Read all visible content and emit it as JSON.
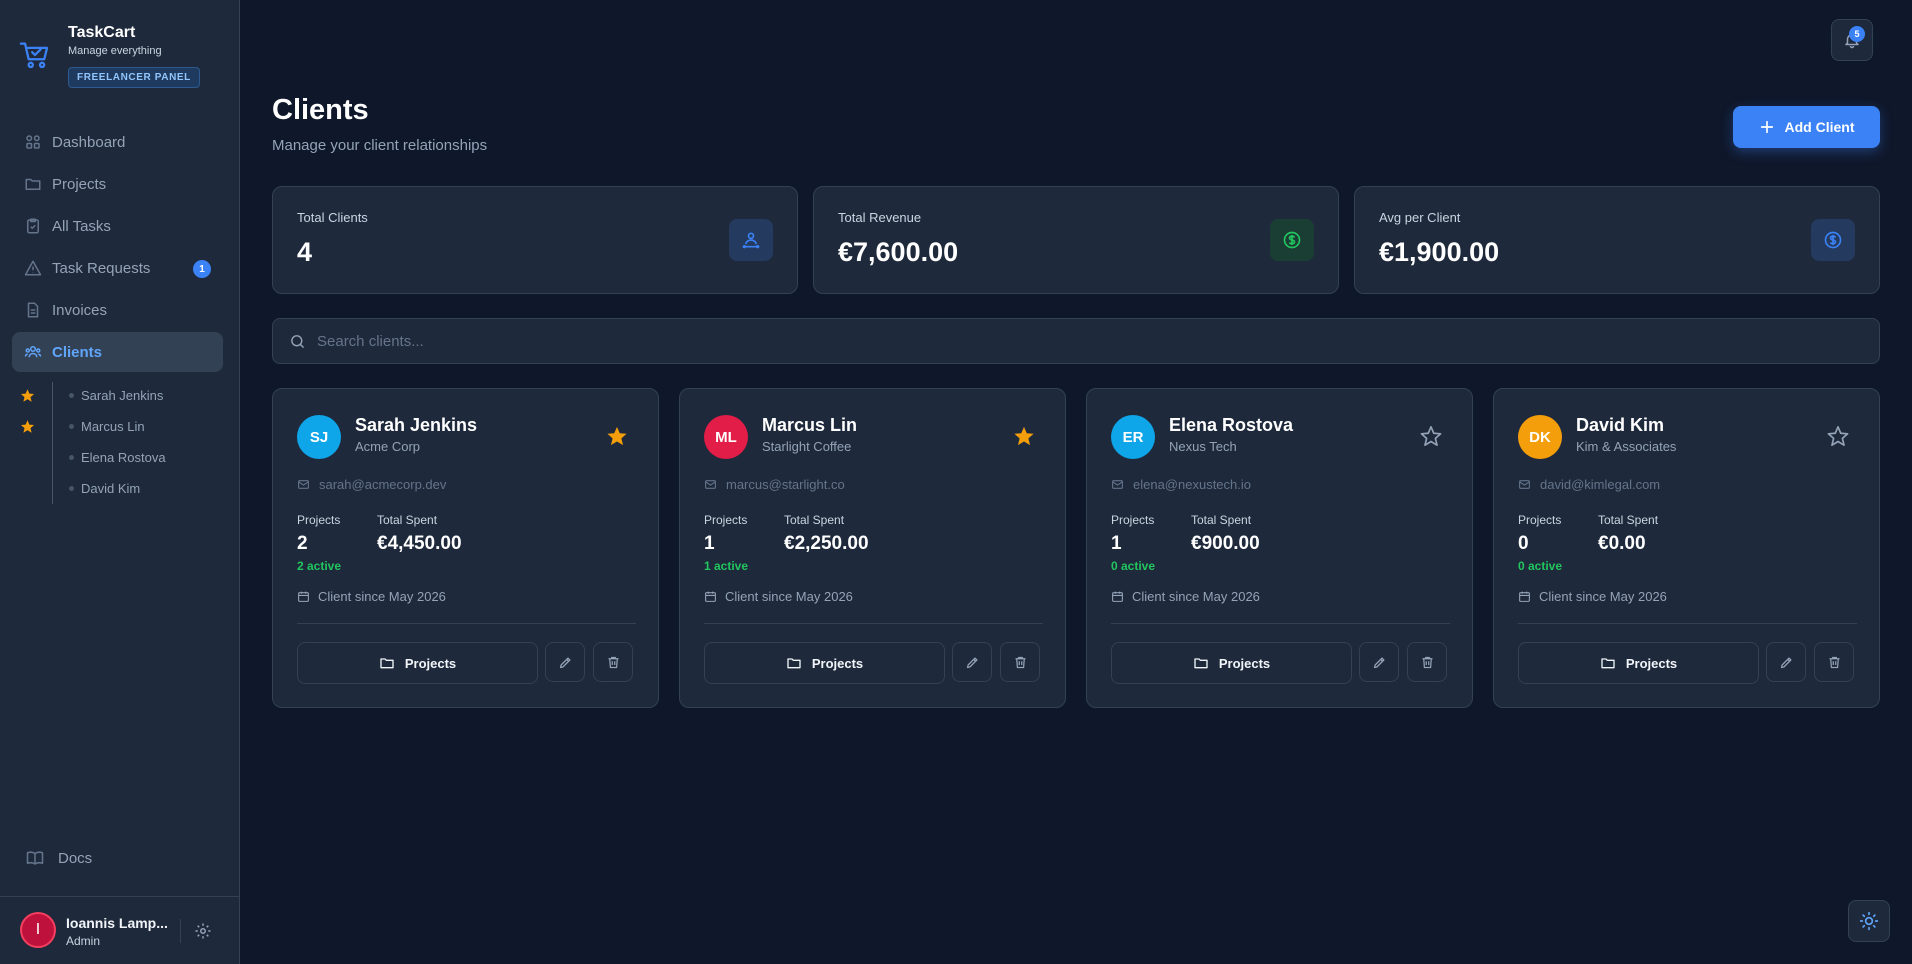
{
  "brand": {
    "name": "TaskCart",
    "subtitle": "Manage everything",
    "badge": "FREELANCER PANEL"
  },
  "nav": {
    "items": [
      {
        "label": "Dashboard",
        "icon": "grid-icon"
      },
      {
        "label": "Projects",
        "icon": "folder-icon"
      },
      {
        "label": "All Tasks",
        "icon": "clipboard-check-icon"
      },
      {
        "label": "Task Requests",
        "icon": "warning-triangle-icon",
        "count": "1"
      },
      {
        "label": "Invoices",
        "icon": "document-icon"
      },
      {
        "label": "Clients",
        "icon": "users-icon",
        "active": true
      }
    ]
  },
  "client_shortcuts": [
    {
      "name": "Sarah Jenkins",
      "starred": true
    },
    {
      "name": "Marcus Lin",
      "starred": true
    },
    {
      "name": "Elena Rostova",
      "starred": false
    },
    {
      "name": "David Kim",
      "starred": false
    }
  ],
  "docs": {
    "label": "Docs",
    "icon": "book-icon"
  },
  "user": {
    "initial": "I",
    "name": "Ioannis Lamp...",
    "role": "Admin"
  },
  "header": {
    "notifications_count": "5"
  },
  "page": {
    "title": "Clients",
    "subtitle": "Manage your client relationships",
    "add_button": "Add Client"
  },
  "stats": [
    {
      "label": "Total Clients",
      "value": "4",
      "icon": "user-network-icon",
      "color": "#3b82f6"
    },
    {
      "label": "Total Revenue",
      "value": "€7,600.00",
      "icon": "dollar-circle-icon",
      "color": "#22c55e"
    },
    {
      "label": "Avg per Client",
      "value": "€1,900.00",
      "icon": "dollar-circle-icon",
      "color": "#3b82f6"
    }
  ],
  "search": {
    "placeholder": "Search clients...",
    "value": ""
  },
  "clients": [
    {
      "initials": "SJ",
      "name": "Sarah Jenkins",
      "company": "Acme Corp",
      "email": "sarah@acmecorp.dev",
      "projects_label": "Projects",
      "projects": "2",
      "active": "2 active",
      "spent_label": "Total Spent",
      "spent": "€4,450.00",
      "since": "Client since May 2026",
      "button": "Projects",
      "starred": true,
      "avatar_color": "#0ea5e9"
    },
    {
      "initials": "ML",
      "name": "Marcus Lin",
      "company": "Starlight Coffee",
      "email": "marcus@starlight.co",
      "projects_label": "Projects",
      "projects": "1",
      "active": "1 active",
      "spent_label": "Total Spent",
      "spent": "€2,250.00",
      "since": "Client since May 2026",
      "button": "Projects",
      "starred": true,
      "avatar_color": "#e11d48"
    },
    {
      "initials": "ER",
      "name": "Elena Rostova",
      "company": "Nexus Tech",
      "email": "elena@nexustech.io",
      "projects_label": "Projects",
      "projects": "1",
      "active": "0 active",
      "spent_label": "Total Spent",
      "spent": "€900.00",
      "since": "Client since May 2026",
      "button": "Projects",
      "starred": false,
      "avatar_color": "#0ea5e9"
    },
    {
      "initials": "DK",
      "name": "David Kim",
      "company": "Kim & Associates",
      "email": "david@kimlegal.com",
      "projects_label": "Projects",
      "projects": "0",
      "active": "0 active",
      "spent_label": "Total Spent",
      "spent": "€0.00",
      "since": "Client since May 2026",
      "button": "Projects",
      "starred": false,
      "avatar_color": "#f59e0b"
    }
  ],
  "colors": {
    "accent": "#3b82f6",
    "star": "#f59e0b",
    "success": "#22c55e",
    "background": "#0f172a",
    "surface": "#1e293b"
  }
}
